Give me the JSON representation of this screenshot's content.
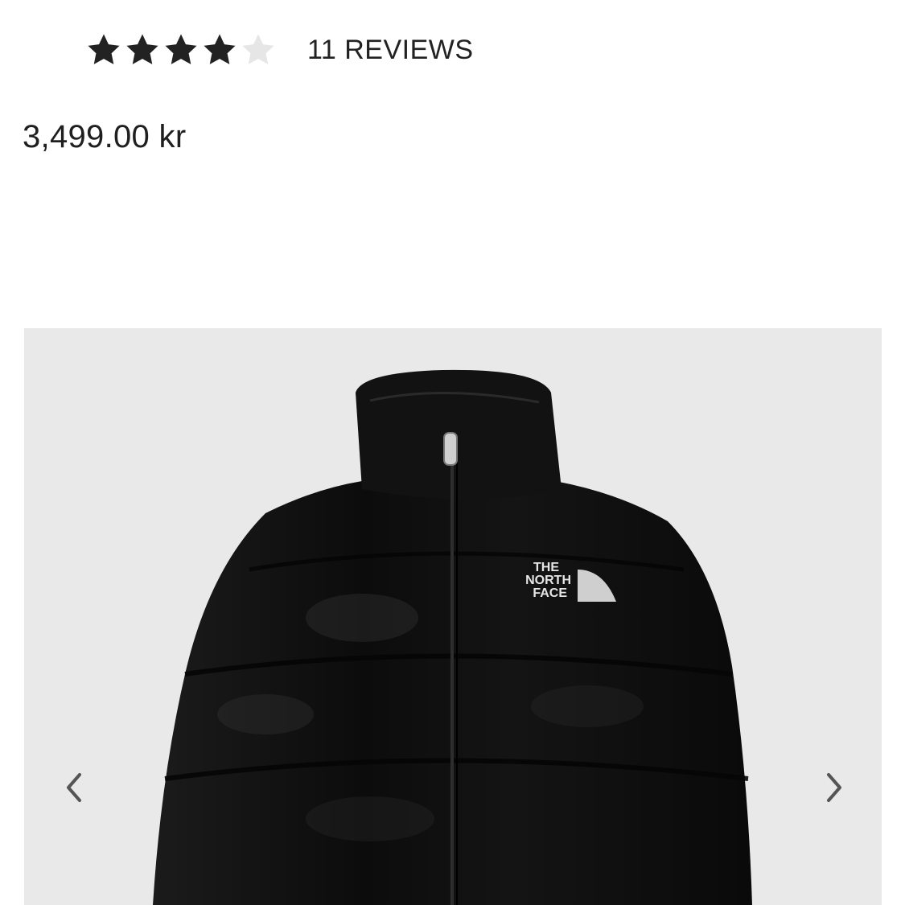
{
  "product": {
    "rating": 4,
    "rating_max": 5,
    "reviews_label": "11 REVIEWS",
    "price": "3,499.00 kr",
    "image_alt": "Black puffer jacket",
    "logo_text": [
      "THE",
      "NORTH",
      "FACE"
    ]
  },
  "gallery": {
    "prev_icon": "chevron-left-icon",
    "next_icon": "chevron-right-icon"
  },
  "colors": {
    "star_filled": "#222222",
    "star_empty": "#e6e6e6",
    "gallery_bg": "#e9e9e9",
    "jacket": "#111111"
  }
}
